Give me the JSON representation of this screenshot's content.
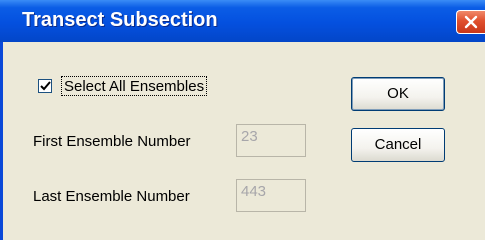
{
  "dialog": {
    "title": "Transect Subsection",
    "select_all_label": "Select All Ensembles",
    "select_all_checked": true,
    "first_label": "First Ensemble Number",
    "first_value": "23",
    "last_label": "Last Ensemble Number",
    "last_value": "443",
    "ok_label": "OK",
    "cancel_label": "Cancel"
  },
  "icons": {
    "close": "close-icon",
    "check": "check-icon"
  }
}
